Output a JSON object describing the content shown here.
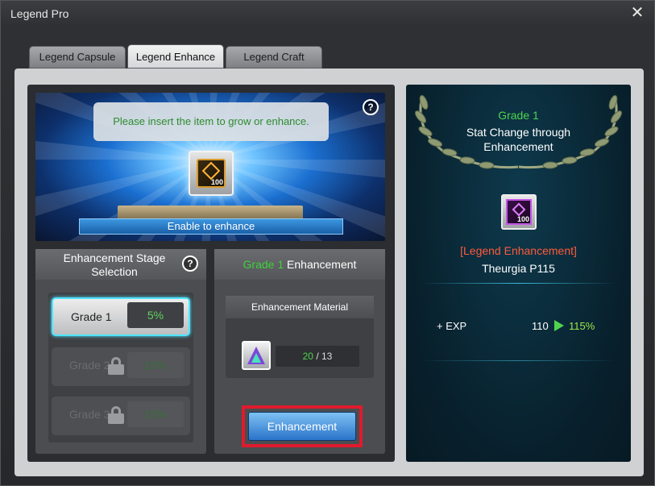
{
  "window": {
    "title": "Legend Pro",
    "close_icon": "close-icon"
  },
  "tabs": [
    {
      "label": "Legend Capsule",
      "active": false
    },
    {
      "label": "Legend Enhance",
      "active": true
    },
    {
      "label": "Legend Craft",
      "active": false
    }
  ],
  "hero": {
    "prompt": "Please insert the item to grow or enhance.",
    "help": "?",
    "item_count": "100",
    "status": "Enable to enhance"
  },
  "stage_selection": {
    "header": "Enhancement Stage Selection",
    "help": "?",
    "grades": [
      {
        "label": "Grade 1",
        "percent": "5%",
        "selected": true,
        "locked": false
      },
      {
        "label": "Grade 2",
        "percent": "10%",
        "selected": false,
        "locked": true
      },
      {
        "label": "Grade 3",
        "percent": "15%",
        "selected": false,
        "locked": true
      }
    ]
  },
  "enhancement": {
    "header_grade": "Grade 1",
    "header_text": "Enhancement",
    "material_title": "Enhancement Material",
    "material_have": "20",
    "material_sep": " / ",
    "material_need": "13",
    "button_label": "Enhancement"
  },
  "result": {
    "grade": "Grade 1",
    "description": "Stat Change through Enhancement",
    "item_count": "100",
    "category": "[Legend Enhancement]",
    "item_name": "Theurgia P115",
    "exp_label": "+ EXP",
    "exp_from": "110",
    "exp_to": "115%"
  },
  "colors": {
    "accent_green": "#4fd34f",
    "highlight_cyan": "#4fe5ff",
    "button_blue": "#2a73c9",
    "focus_red": "#e01a2e",
    "category_red": "#ff5a3a"
  }
}
